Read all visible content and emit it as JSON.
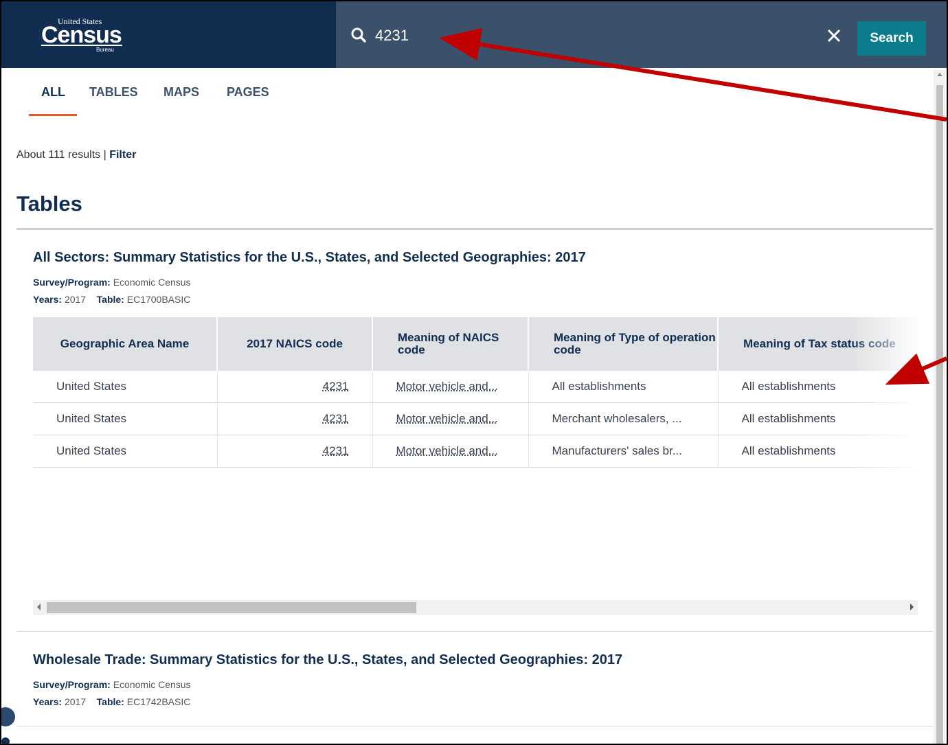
{
  "header": {
    "logo_line1": "United States",
    "logo_line2": "Census",
    "logo_line3": "Bureau",
    "search_value": "4231",
    "search_button": "Search",
    "colors": {
      "brand": "#112e51",
      "search_bar": "#3b506b",
      "search_button": "#0a7c8c"
    }
  },
  "tabs": [
    {
      "label": "ALL",
      "active": true
    },
    {
      "label": "TABLES"
    },
    {
      "label": "MAPS"
    },
    {
      "label": "PAGES"
    }
  ],
  "results": {
    "count_text": "About 111 results |",
    "filter_label": "Filter"
  },
  "section_title": "Tables",
  "cards": [
    {
      "title": "All Sectors: Summary Statistics for the U.S., States, and Selected Geographies: 2017",
      "survey_label": "Survey/Program:",
      "survey_value": "Economic Census",
      "years_label": "Years:",
      "years_value": "2017",
      "table_label": "Table:",
      "table_value": "EC1700BASIC",
      "columns": [
        "Geographic Area Name",
        "2017 NAICS code",
        "Meaning of NAICS code",
        "Meaning of Type of operation code",
        "Meaning of Tax status code"
      ],
      "rows": [
        [
          "United States",
          "4231",
          "Motor vehicle and...",
          "All establishments",
          "All establishments"
        ],
        [
          "United States",
          "4231",
          "Motor vehicle and...",
          "Merchant wholesalers, ...",
          "All establishments"
        ],
        [
          "United States",
          "4231",
          "Motor vehicle and...",
          "Manufacturers' sales br...",
          "All establishments"
        ]
      ]
    },
    {
      "title": "Wholesale Trade: Summary Statistics for the U.S., States, and Selected Geographies: 2017",
      "survey_label": "Survey/Program:",
      "survey_value": "Economic Census",
      "years_label": "Years:",
      "years_value": "2017",
      "table_label": "Table:",
      "table_value": "EC1742BASIC"
    }
  ],
  "icons": {
    "search": "search-icon",
    "clear": "close-icon"
  },
  "annotation_color": "#c00000"
}
